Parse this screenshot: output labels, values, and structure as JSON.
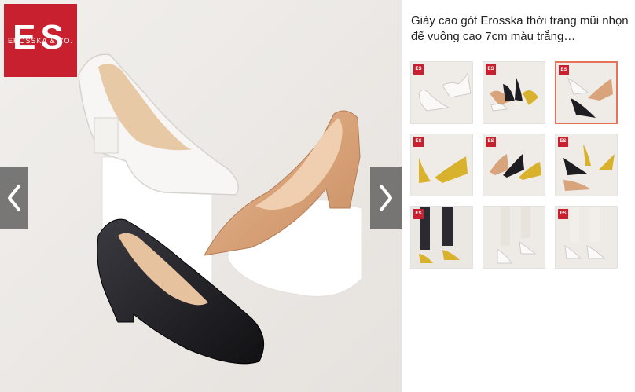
{
  "gallery": {
    "brand_logo": {
      "initials": "ES",
      "name": "EROSSKA & CO."
    },
    "main_image": "white, tan and black pointed block-heel pumps on white blocks",
    "prev_icon": "chevron-left-icon",
    "next_icon": "chevron-right-icon"
  },
  "product": {
    "title": "Giày cao gót Erosska thời trang mũi nhọn đế vuông cao 7cm màu trắng…"
  },
  "thumbnails": [
    {
      "label": "white pumps",
      "logo": "ES",
      "selected": false
    },
    {
      "label": "assorted colors",
      "logo": "ES",
      "selected": false
    },
    {
      "label": "white, black, tan",
      "logo": "ES",
      "selected": true
    },
    {
      "label": "yellow pumps",
      "logo": "ES",
      "selected": false
    },
    {
      "label": "tan, black, yellow",
      "logo": "ES",
      "selected": false
    },
    {
      "label": "black and yellow",
      "logo": "ES",
      "selected": false
    },
    {
      "label": "model wearing yellow",
      "logo": "ES",
      "selected": false
    },
    {
      "label": "model wearing white",
      "logo": "",
      "selected": false
    },
    {
      "label": "white pumps on model",
      "logo": "ES",
      "selected": false
    }
  ],
  "colors": {
    "brand_red": "#c8202e",
    "selected_border": "#e4735a",
    "shoe_white": "#f7f6f4",
    "shoe_tan": "#d9a37b",
    "shoe_black": "#1e1e22",
    "shoe_yellow": "#d8b22c"
  }
}
